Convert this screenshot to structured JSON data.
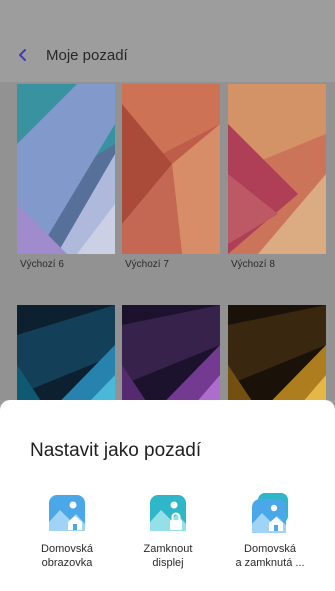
{
  "header": {
    "title": "Moje pozadí"
  },
  "wallpapers": [
    {
      "label": "Výchozí 6"
    },
    {
      "label": "Výchozí 7"
    },
    {
      "label": "Výchozí 8"
    }
  ],
  "sheet": {
    "title": "Nastavit jako pozadí",
    "options": [
      {
        "line1": "Domovská",
        "line2": "obrazovka",
        "icon": "home-screen-icon"
      },
      {
        "line1": "Zamknout",
        "line2": "displej",
        "icon": "lock-screen-icon"
      },
      {
        "line1": "Domovská",
        "line2": "a zamknutá ...",
        "icon": "home-and-lock-icon"
      }
    ]
  }
}
